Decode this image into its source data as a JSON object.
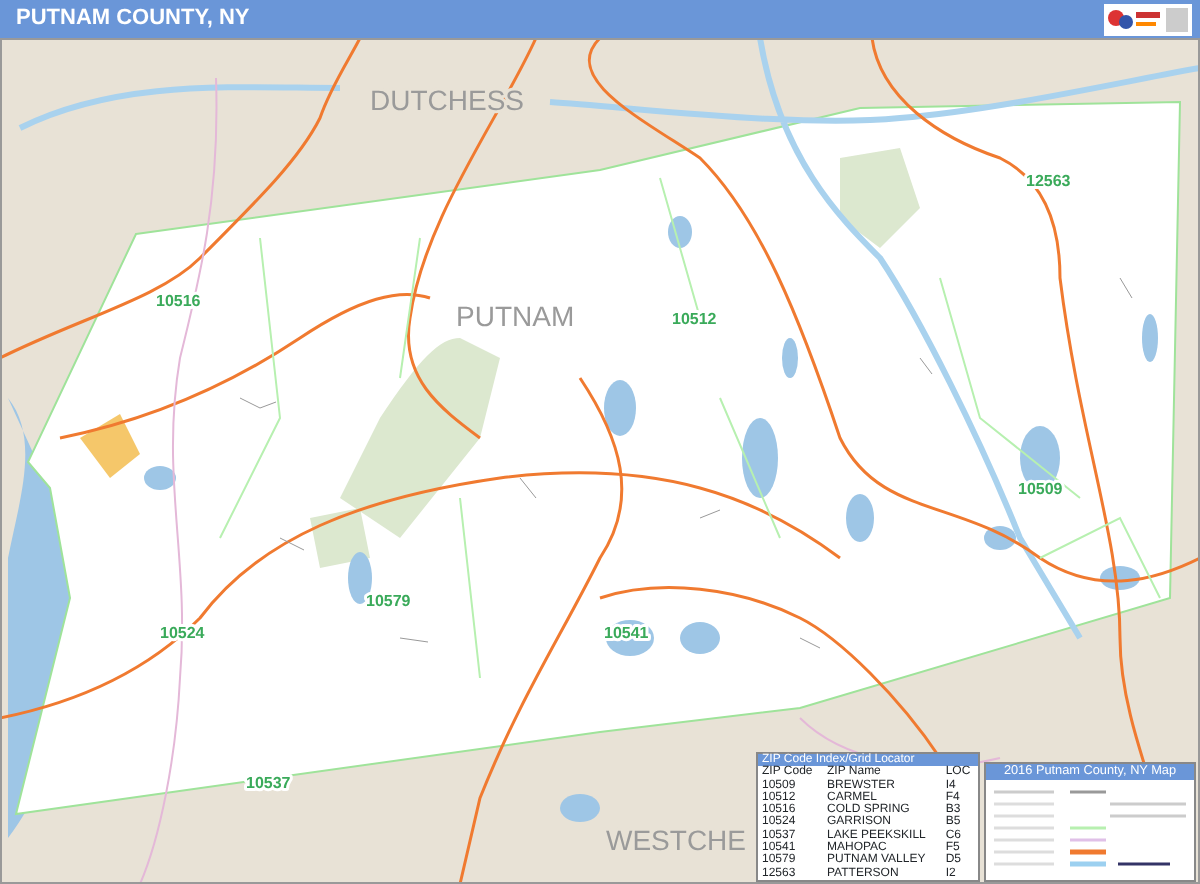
{
  "header": {
    "title": "PUTNAM COUNTY, NY"
  },
  "map": {
    "labels": [
      {
        "text": "DUTCHESS",
        "kind": "county"
      },
      {
        "text": "PUTNAM",
        "kind": "county"
      },
      {
        "text": "WESTCHE",
        "kind": "county"
      },
      {
        "text": "10516",
        "kind": "zip"
      },
      {
        "text": "10512",
        "kind": "zip"
      },
      {
        "text": "12563",
        "kind": "zip"
      },
      {
        "text": "10509",
        "kind": "zip"
      },
      {
        "text": "10579",
        "kind": "zip"
      },
      {
        "text": "10524",
        "kind": "zip"
      },
      {
        "text": "10541",
        "kind": "zip"
      },
      {
        "text": "10537",
        "kind": "zip"
      }
    ]
  },
  "zip_index": {
    "title": "ZIP Code Index/Grid Locator",
    "columns": [
      "ZIP Code",
      "ZIP Name",
      "LOC"
    ],
    "rows": [
      [
        "10509",
        "BREWSTER",
        "I4"
      ],
      [
        "10512",
        "CARMEL",
        "F4"
      ],
      [
        "10516",
        "COLD SPRING",
        "B3"
      ],
      [
        "10524",
        "GARRISON",
        "B5"
      ],
      [
        "10537",
        "LAKE PEEKSKILL",
        "C6"
      ],
      [
        "10541",
        "MAHOPAC",
        "F5"
      ],
      [
        "10579",
        "PUTNAM VALLEY",
        "D5"
      ],
      [
        "12563",
        "PATTERSON",
        "I2"
      ]
    ]
  },
  "legend": {
    "title": "2016 Putnam County, NY Map"
  }
}
